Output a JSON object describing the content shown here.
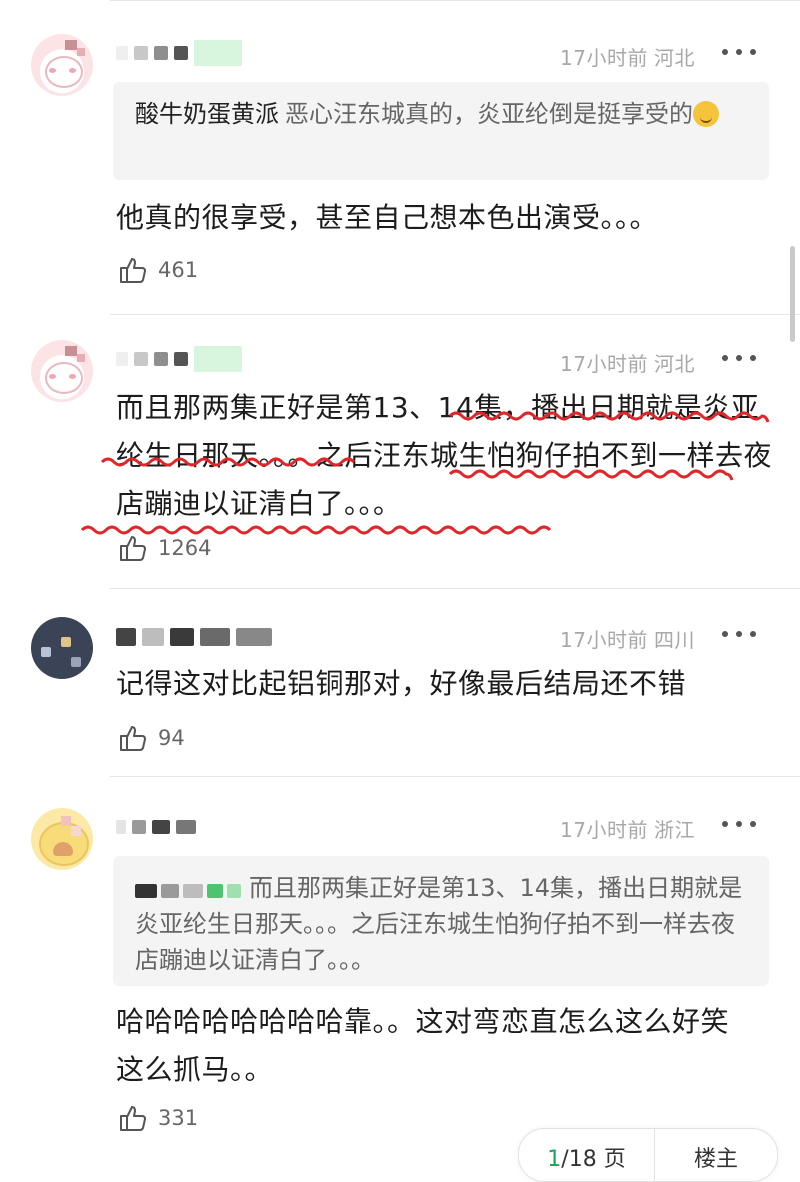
{
  "colors": {
    "accent_green": "#19a35b",
    "annotation_red": "#e0262b",
    "meta_gray": "#a8a8a8",
    "quote_bg": "#f4f4f4"
  },
  "comments": [
    {
      "avatar_icon": "pink-pig-avatar-icon",
      "time": "17小时前",
      "region": "河北",
      "quote": {
        "name": "酸牛奶蛋黄派",
        "text": "恶心汪东城真的，炎亚纶倒是挺享受的"
      },
      "text": "他真的很享受，甚至自己想本色出演受。。。",
      "likes": "461"
    },
    {
      "avatar_icon": "pink-pig-avatar-icon",
      "time": "17小时前",
      "region": "河北",
      "text": "而且那两集正好是第13、14集，播出日期就是炎亚纶生日那天。。。之后汪东城生怕狗仔拍不到一样去夜店蹦迪以证清白了。。。",
      "likes": "1264"
    },
    {
      "avatar_icon": "dark-photo-avatar-icon",
      "time": "17小时前",
      "region": "四川",
      "text": "记得这对比起铝铜那对，好像最后结局还不错",
      "likes": "94"
    },
    {
      "avatar_icon": "yellow-cartoon-avatar-icon",
      "time": "17小时前",
      "region": "浙江",
      "quote": {
        "text": "而且那两集正好是第13、14集，播出日期就是炎亚纶生日那天。。。之后汪东城生怕狗仔拍不到一样去夜店蹦迪以证清白了。。。"
      },
      "text": "哈哈哈哈哈哈哈哈靠。。这对弯恋直怎么这么好笑这么抓马。。",
      "likes": "331"
    }
  ],
  "pagination": {
    "current": "1",
    "total_label": "/18 页",
    "next_label": "楼主"
  }
}
